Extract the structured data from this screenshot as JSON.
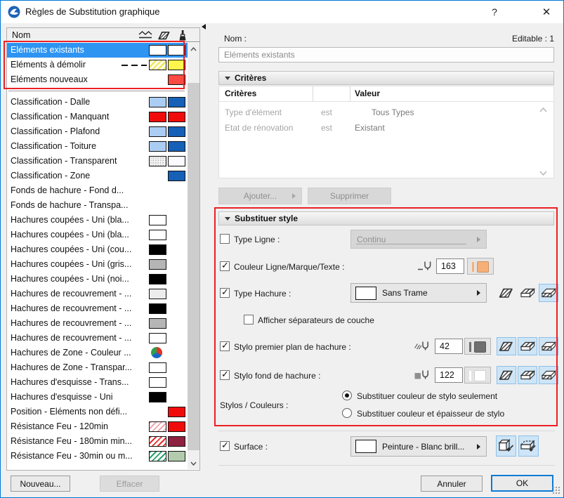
{
  "window": {
    "title": "Règles de Substitution graphique",
    "help_label": "?",
    "close_label": "✕"
  },
  "colors": {
    "selection_blue": "#2e94f2",
    "annotation_red": "#ec1f24",
    "toggle_selected_bg": "#cde5f7",
    "window_border": "#0079d8"
  },
  "left_panel": {
    "header": {
      "name_col": "Nom"
    },
    "items": [
      {
        "label": "Eléments existants",
        "selected": true,
        "sw1": {
          "t": "solid",
          "c": "#ffffff"
        },
        "sw2": {
          "t": "solid",
          "c": "#ffffff"
        }
      },
      {
        "label": "Eléments à démolir",
        "dash": true,
        "sw1": {
          "t": "hatch",
          "c": "#fffde8",
          "s": "#f0e14a"
        },
        "sw2": {
          "t": "solid",
          "c": "#fdf44d"
        }
      },
      {
        "label": "Eléments nouveaux",
        "divider": true,
        "sw2": {
          "t": "solid",
          "c": "#fa4b42"
        }
      },
      {
        "label": "Classification - Dalle",
        "sw1": {
          "t": "solid",
          "c": "#abcdf3"
        },
        "sw2": {
          "t": "solid",
          "c": "#1660b8"
        }
      },
      {
        "label": "Classification - Manquant",
        "sw1": {
          "t": "solid",
          "c": "#f10c0c"
        },
        "sw2": {
          "t": "solid",
          "c": "#f10c0c"
        }
      },
      {
        "label": "Classification - Plafond",
        "sw1": {
          "t": "solid",
          "c": "#abcdf3"
        },
        "sw2": {
          "t": "solid",
          "c": "#1660b8"
        }
      },
      {
        "label": "Classification - Toiture",
        "sw1": {
          "t": "solid",
          "c": "#abcdf3"
        },
        "sw2": {
          "t": "solid",
          "c": "#1660b8"
        }
      },
      {
        "label": "Classification - Transparent",
        "sw1": {
          "t": "dots"
        },
        "sw2": {
          "t": "solid",
          "c": "#fafaff"
        }
      },
      {
        "label": "Classification - Zone",
        "sw2": {
          "t": "solid",
          "c": "#1660b8"
        }
      },
      {
        "label": "Fonds de hachure  - Fond d..."
      },
      {
        "label": "Fonds de hachure  - Transpa..."
      },
      {
        "label": "Hachures coupées - Uni (bla...",
        "sw1": {
          "t": "solid",
          "c": "#ffffff"
        }
      },
      {
        "label": "Hachures coupées - Uni (bla...",
        "sw1": {
          "t": "solid",
          "c": "#ffffff"
        }
      },
      {
        "label": "Hachures coupées - Uni (cou...",
        "sw1": {
          "t": "solid",
          "c": "#000000"
        }
      },
      {
        "label": "Hachures coupées - Uni (gris...",
        "sw1": {
          "t": "solid",
          "c": "#b5b5b5"
        }
      },
      {
        "label": "Hachures coupées - Uni (noi...",
        "sw1": {
          "t": "solid",
          "c": "#000000"
        }
      },
      {
        "label": "Hachures de recouvrement - ...",
        "sw1": {
          "t": "solid",
          "c": "#ececec"
        }
      },
      {
        "label": "Hachures de recouvrement - ...",
        "sw1": {
          "t": "solid",
          "c": "#000000"
        }
      },
      {
        "label": "Hachures de recouvrement - ...",
        "sw1": {
          "t": "solid",
          "c": "#b5b5b5"
        }
      },
      {
        "label": "Hachures de recouvrement - ...",
        "sw1": {
          "t": "solid",
          "c": "#ffffff"
        }
      },
      {
        "label": "Hachures de Zone - Couleur ...",
        "sw1": {
          "t": "pie"
        }
      },
      {
        "label": "Hachures de Zone - Transpar...",
        "sw1": {
          "t": "solid",
          "c": "#ffffff"
        }
      },
      {
        "label": "Hachures d'esquisse - Trans...",
        "sw1": {
          "t": "solid",
          "c": "#ffffff"
        }
      },
      {
        "label": "Hachures d'esquisse - Uni",
        "sw1": {
          "t": "solid",
          "c": "#000000"
        }
      },
      {
        "label": "Position - Eléments non défi...",
        "sw2": {
          "t": "solid",
          "c": "#f10c0c"
        }
      },
      {
        "label": "Résistance Feu - 120min",
        "sw1": {
          "t": "hatch",
          "c": "#ffffff",
          "s": "#efa6ad"
        },
        "sw2": {
          "t": "solid",
          "c": "#f10c0c"
        }
      },
      {
        "label": "Résistance Feu - 180min min...",
        "sw1": {
          "t": "hatch",
          "c": "#ffffff",
          "s": "#e82d2d"
        },
        "sw2": {
          "t": "solid",
          "c": "#8e2140"
        }
      },
      {
        "label": "Résistance Feu - 30min ou m...",
        "sw1": {
          "t": "hatch",
          "c": "#ffffff",
          "s": "#28a169"
        },
        "sw2": {
          "t": "solid",
          "c": "#b2cbad"
        }
      }
    ],
    "buttons": {
      "new": "Nouveau...",
      "delete": "Effacer"
    }
  },
  "right_panel": {
    "name_label": "Nom :",
    "editable_label": "Editable : 1",
    "name_value": "Eléments existants",
    "criteria": {
      "section_title": "Critères",
      "col_criteria": "Critères",
      "col_value": "Valeur",
      "rows": [
        {
          "criterion": "Type d'élément",
          "op": "est",
          "value": "Tous Types",
          "indent": true
        },
        {
          "criterion": "Etat de rénovation",
          "op": "est",
          "value": "Existant",
          "indent": false
        }
      ],
      "add_button": "Ajouter...",
      "remove_button": "Supprimer"
    },
    "override": {
      "section_title": "Substituer style",
      "line_type": {
        "label": "Type Ligne :",
        "checked": false,
        "value": "Continu"
      },
      "line_color": {
        "label": "Couleur Ligne/Marque/Texte :",
        "checked": true,
        "pen": "163",
        "color": "#f6b077"
      },
      "fill_type": {
        "label": "Type Hachure :",
        "checked": true,
        "value": "Sans Trame",
        "toggles": [
          false,
          false,
          true
        ]
      },
      "separators": {
        "label": "Afficher séparateurs de couche",
        "checked": false
      },
      "fill_fg": {
        "label": "Stylo premier plan de hachure :",
        "checked": true,
        "pen": "42",
        "color": "#6f6f6f",
        "toggles": [
          true,
          true,
          true
        ]
      },
      "fill_bg": {
        "label": "Stylo fond de hachure :",
        "checked": true,
        "pen": "122",
        "color": "#ffffff",
        "toggles": [
          true,
          true,
          true
        ]
      },
      "pens": {
        "label": "Stylos / Couleurs :",
        "options": [
          {
            "label": "Substituer couleur de stylo seulement",
            "selected": true
          },
          {
            "label": "Substituer couleur et épaisseur de stylo",
            "selected": false
          }
        ]
      }
    },
    "surface": {
      "label": "Surface :",
      "checked": true,
      "value": "Peinture - Blanc brill...",
      "toggles": [
        true,
        true
      ]
    },
    "footer": {
      "cancel": "Annuler",
      "ok": "OK"
    }
  }
}
